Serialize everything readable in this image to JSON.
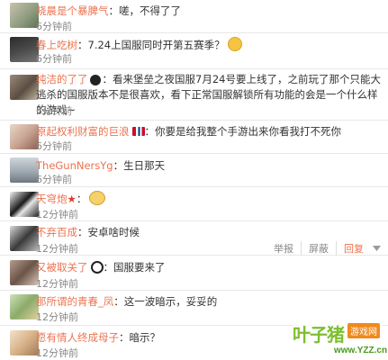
{
  "comments": [
    {
      "user": "晓晨是个暴脾气",
      "text": "：嗟，不得了了",
      "time": "6分钟前"
    },
    {
      "user": "春上吃树",
      "text": "：7.24上国服同时开第五赛季？",
      "time": "6分钟前"
    },
    {
      "user": "纯洁的了了",
      "text": "：看来堡垒之夜国服7月24号要上线了，之前玩了那个只能大逃杀的国服版本不是很喜欢，看下正常国服解锁所有功能的会是一个什么样的游戏~",
      "time": "6分钟前"
    },
    {
      "user": "原起权利财富的巨浪",
      "text": "：你要是给我整个手游出来你看我打不死你",
      "time": "6分钟前"
    },
    {
      "user": "TheGunNersYg",
      "text": "：生日那天",
      "time": "6分钟前"
    },
    {
      "user": "天穹炮",
      "text": "：",
      "time": "12分钟前"
    },
    {
      "user": "不弃百成",
      "text": "：安卓啥时候",
      "time": "12分钟前"
    },
    {
      "user": "又被取关了",
      "text": "：国服要来了",
      "time": "12分钟前"
    },
    {
      "user": "那所谓的青春_凤",
      "text": "：这一波暗示，妥妥的",
      "time": "12分钟前"
    },
    {
      "user": "愿有情人终成母子",
      "text": "：暗示？",
      "time": "12分钟前"
    }
  ],
  "actions": {
    "report": "举报",
    "block": "屏蔽",
    "reply": "回复"
  },
  "watermark": {
    "brand": "叶子猪",
    "sub": "游戏网",
    "url": "www.YZZ.cn"
  }
}
